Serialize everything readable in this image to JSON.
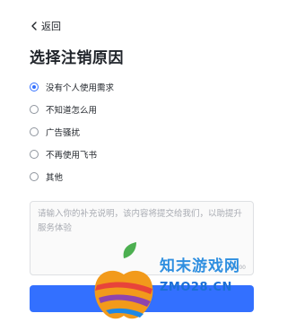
{
  "header": {
    "back_label": "返回"
  },
  "page": {
    "title": "选择注销原因"
  },
  "reasons": [
    {
      "label": "没有个人使用需求",
      "selected": true
    },
    {
      "label": "不知道怎么用",
      "selected": false
    },
    {
      "label": "广告骚扰",
      "selected": false
    },
    {
      "label": "不再使用飞书",
      "selected": false
    },
    {
      "label": "其他",
      "selected": false
    }
  ],
  "supplement": {
    "placeholder": "请输入你的补充说明，该内容将提交给我们，以助提升服务体验",
    "counter": "0/200"
  },
  "actions": {
    "next_label": "步"
  },
  "colors": {
    "accent": "#3370ff"
  },
  "watermark": {
    "brand": "知末游戏网",
    "url": "ZMO28.CN"
  }
}
